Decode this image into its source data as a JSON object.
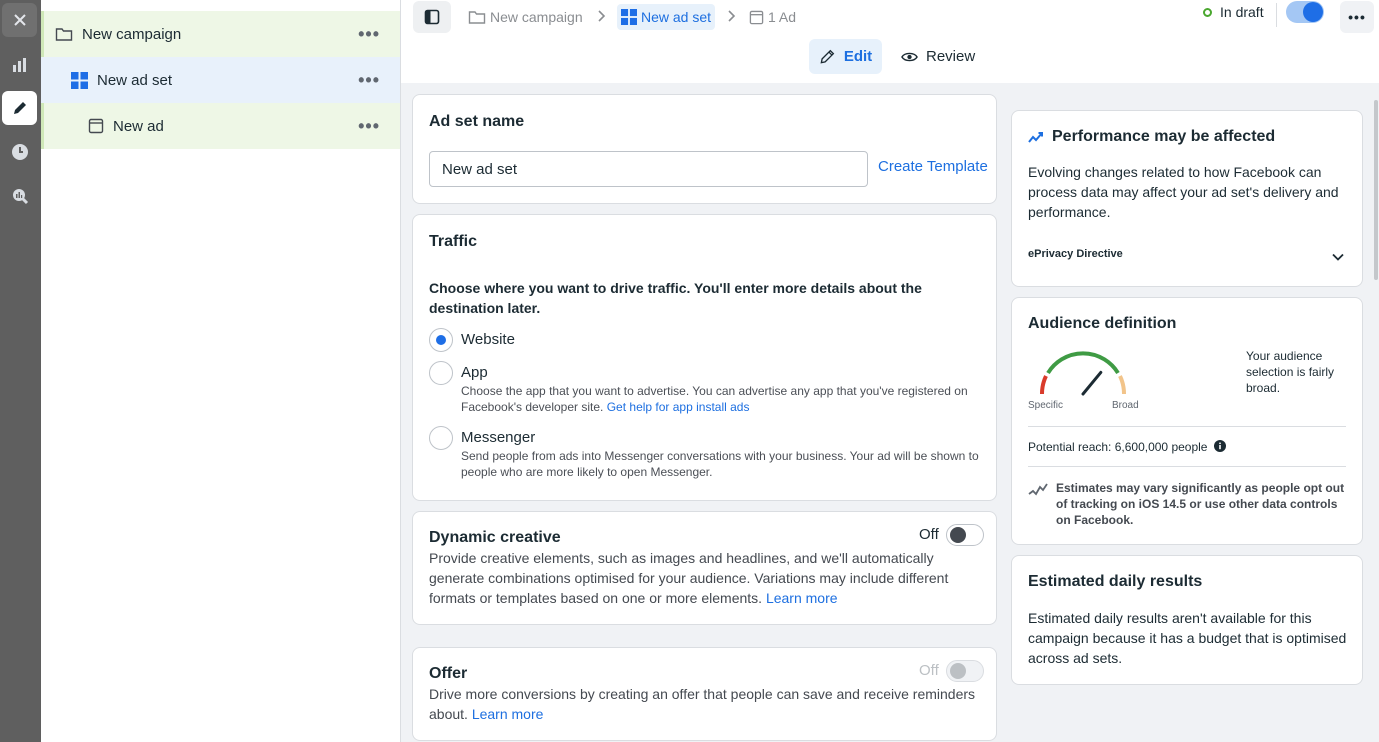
{
  "colors": {
    "accent": "#1d6fe0",
    "draft_dot": "#4aa72f",
    "rail": "#5f5f5f"
  },
  "rail": {
    "icons": [
      "close-icon",
      "chart-icon",
      "pencil-icon",
      "clock-icon",
      "magnify-chart-icon"
    ],
    "active": "pencil-icon"
  },
  "tree": {
    "items": [
      {
        "label": "New campaign",
        "icon": "folder-icon",
        "more": "•••"
      },
      {
        "label": "New ad set",
        "icon": "grid-icon",
        "more": "•••"
      },
      {
        "label": "New ad",
        "icon": "ad-icon",
        "more": "•••"
      }
    ]
  },
  "header": {
    "breadcrumb": [
      {
        "label": "New campaign",
        "icon": "folder-icon"
      },
      {
        "label": "New ad set",
        "icon": "grid-icon"
      },
      {
        "label": "1 Ad",
        "icon": "ad-icon"
      }
    ],
    "separator": ">",
    "status": "In draft",
    "more": "•••",
    "edit_label": "Edit",
    "review_label": "Review"
  },
  "adset_name": {
    "title": "Ad set name",
    "value": "New ad set",
    "create_template": "Create Template"
  },
  "traffic": {
    "title": "Traffic",
    "prompt": "Choose where you want to drive traffic. You'll enter more details about the destination later.",
    "options": [
      {
        "label": "Website",
        "checked": true,
        "desc": "",
        "link": ""
      },
      {
        "label": "App",
        "checked": false,
        "desc": "Choose the app that you want to advertise. You can advertise any app that you've registered on Facebook's developer site.",
        "link": "Get help for app install ads"
      },
      {
        "label": "Messenger",
        "checked": false,
        "desc": "Send people from ads into Messenger conversations with your business. Your ad will be shown to people who are more likely to open Messenger.",
        "link": ""
      }
    ]
  },
  "dynamic_creative": {
    "title": "Dynamic creative",
    "state": "Off",
    "desc": "Provide creative elements, such as images and headlines, and we'll automatically generate combinations optimised for your audience. Variations may include different formats or templates based on one or more elements.",
    "learn_more": "Learn more"
  },
  "offer": {
    "title": "Offer",
    "state": "Off",
    "desc": "Drive more conversions by creating an offer that people can save and receive reminders about.",
    "learn_more": "Learn more"
  },
  "performance": {
    "title": "Performance may be affected",
    "body": "Evolving changes related to how Facebook can process data may affect your ad set's delivery and performance.",
    "directive": "ePrivacy Directive"
  },
  "audience": {
    "title": "Audience definition",
    "gauge_low": "Specific",
    "gauge_high": "Broad",
    "gauge_level": 0.72,
    "summary": "Your audience selection is fairly broad.",
    "reach": "Potential reach: 6,600,000 people",
    "note": "Estimates may vary significantly as people opt out of tracking on iOS 14.5 or use other data controls on Facebook."
  },
  "daily": {
    "title": "Estimated daily results",
    "body": "Estimated daily results aren't available for this campaign because it has a budget that is optimised across ad sets."
  }
}
